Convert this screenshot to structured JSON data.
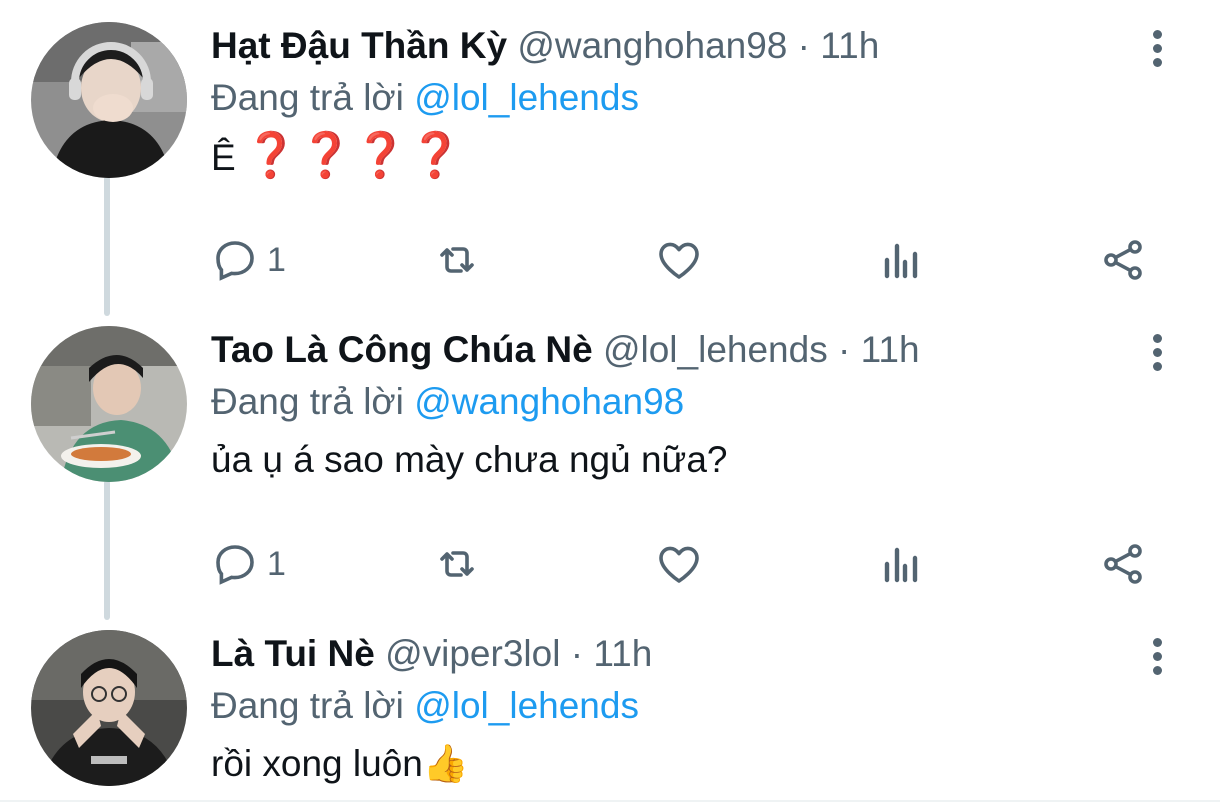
{
  "tweets": [
    {
      "name": "Hạt Đậu Thần Kỳ",
      "handle": "@wanghohan98",
      "dot": "·",
      "time": "11h",
      "reply_prefix": "Đang trả lời",
      "reply_to": "@lol_lehends",
      "text": "Ê",
      "emoji": "❓❓❓❓",
      "reply_count": "1"
    },
    {
      "name": "Tao Là Công Chúa Nè",
      "handle": "@lol_lehends",
      "dot": "·",
      "time": "11h",
      "reply_prefix": "Đang trả lời",
      "reply_to": "@wanghohan98",
      "text": "ủa ụ á sao mày chưa ngủ nữa?",
      "reply_count": "1"
    },
    {
      "name": "Là Tui Nè",
      "handle": "@viper3lol",
      "dot": "·",
      "time": "11h",
      "reply_prefix": "Đang trả lời",
      "reply_to": "@lol_lehends",
      "text": "rồi xong luôn",
      "emoji": "👍"
    }
  ],
  "icons": {
    "reply": "reply-icon",
    "retweet": "retweet-icon",
    "like": "heart-icon",
    "analytics": "analytics-icon",
    "share": "share-icon",
    "more": "more-options-icon"
  },
  "colors": {
    "link": "#1d9bf0",
    "secondary": "#536471",
    "thread_line": "#cfd9de"
  }
}
